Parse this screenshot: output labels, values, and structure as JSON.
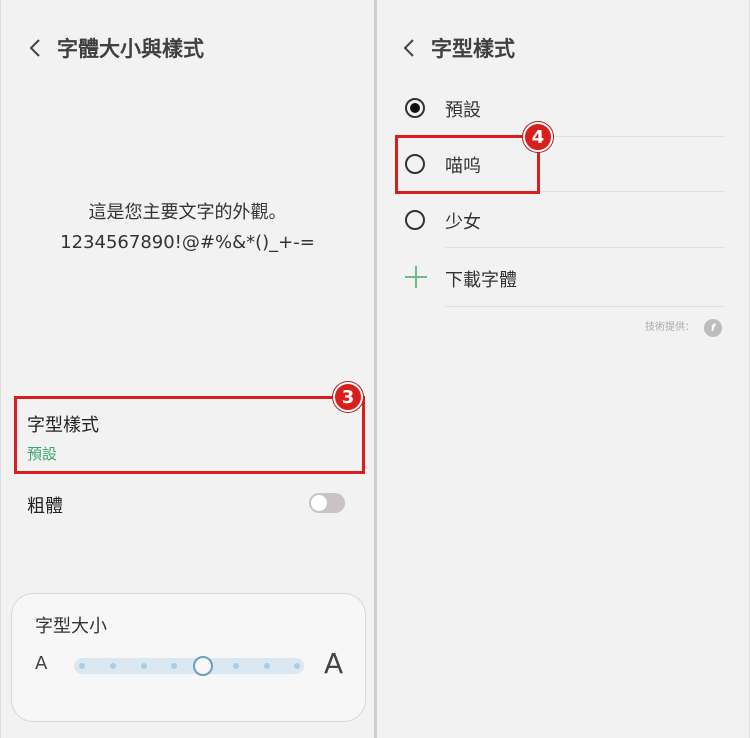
{
  "left": {
    "title": "字體大小與樣式",
    "preview_line1": "這是您主要文字的外觀。",
    "preview_line2": "1234567890!@#%&*()_+-=",
    "font_style": {
      "title": "字型樣式",
      "value": "預設",
      "badge": "3"
    },
    "bold": {
      "label": "粗體",
      "enabled": false
    },
    "font_size": {
      "title": "字型大小",
      "small_label": "A",
      "large_label": "A",
      "level": 5,
      "steps": 8
    }
  },
  "right": {
    "title": "字型樣式",
    "options": [
      {
        "label": "預設",
        "selected": true
      },
      {
        "label": "喵呜",
        "selected": false
      },
      {
        "label": "少女",
        "selected": false
      }
    ],
    "download_label": "下載字體",
    "badge": "4",
    "tech_provider": "技術提供：",
    "tech_logo": "f"
  },
  "colors": {
    "highlight": "#d91e1e",
    "accent_green": "#3ca66d"
  }
}
